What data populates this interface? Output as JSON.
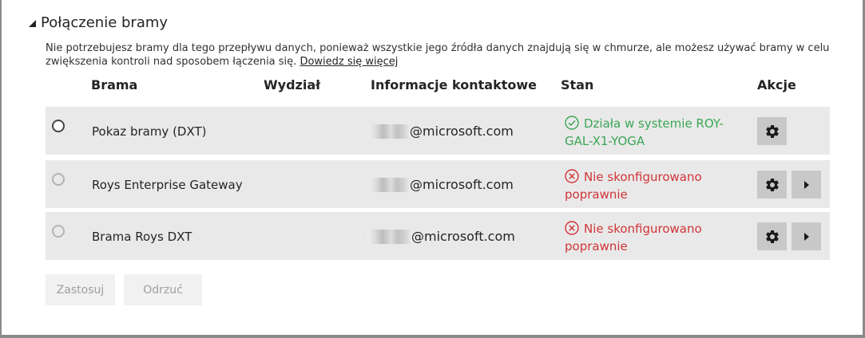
{
  "section": {
    "title": "Połączenie bramy"
  },
  "description": {
    "text": "Nie potrzebujesz bramy dla tego przepływu danych, ponieważ wszystkie jego źródła danych znajdują się w chmurze, ale możesz używać bramy w celu zwiększenia kontroli nad sposobem łączenia się. ",
    "link": "Dowiedz się więcej"
  },
  "columns": {
    "gateway": "Brama",
    "department": "Wydział",
    "contact": "Informacje kontaktowe",
    "status": "Stan",
    "actions": "Akcje"
  },
  "rows": [
    {
      "name": "Pokaz bramy (DXT)",
      "contact": "@microsoft.com",
      "status": "Działa w systemie ROY-GAL-X1-YOGA",
      "status_type": "ok",
      "selected": true
    },
    {
      "name": "Roys Enterprise Gateway",
      "contact": "@microsoft.com",
      "status": "Nie skonfigurowano poprawnie",
      "status_type": "error",
      "selected": false
    },
    {
      "name": "Brama Roys DXT",
      "contact": "@microsoft.com",
      "status": "Nie skonfigurowano poprawnie",
      "status_type": "error",
      "selected": false
    }
  ],
  "buttons": {
    "apply": "Zastosuj",
    "discard": "Odrzuć"
  },
  "colors": {
    "ok": "#3aa655",
    "error": "#d13438",
    "row_bg": "#e9e9e9",
    "action_bg": "#c8c8c8"
  },
  "icons": {
    "settings": "gear-icon",
    "expand": "play-arrow-icon",
    "ok": "check-circle-icon",
    "error": "error-circle-icon"
  }
}
